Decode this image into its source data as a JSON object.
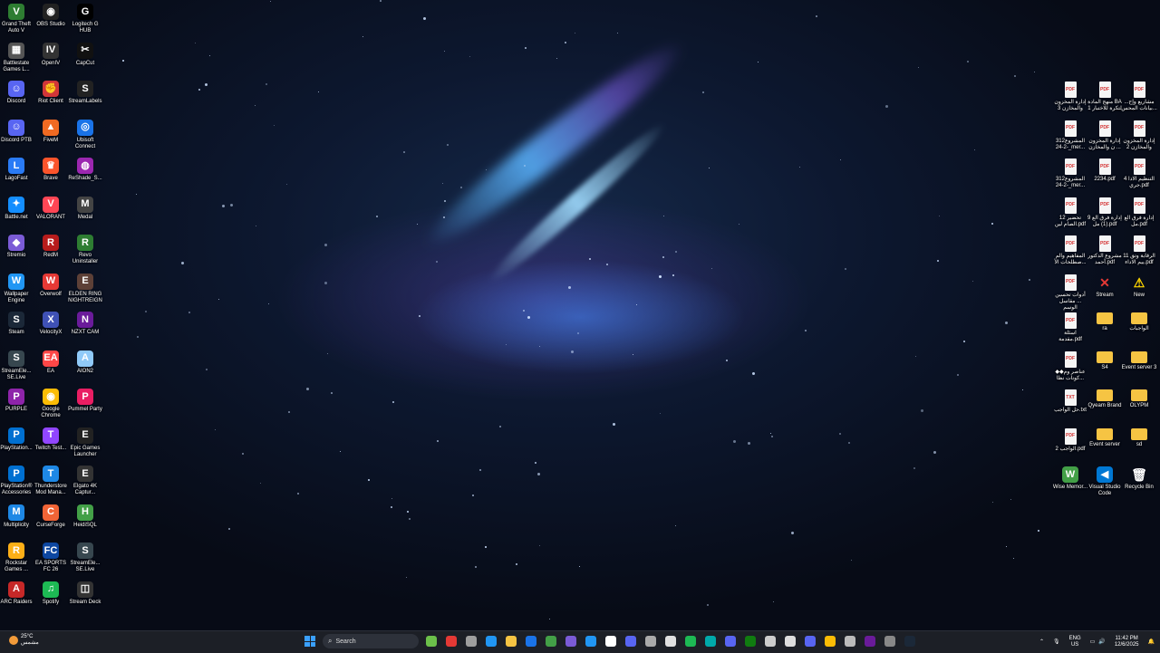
{
  "left_icons": [
    {
      "label": "Grand Theft Auto V",
      "glyph": "V",
      "color": "#2e7d32"
    },
    {
      "label": "OBS Studio",
      "glyph": "◉",
      "color": "#222"
    },
    {
      "label": "Logitech G HUB",
      "glyph": "G",
      "color": "#000"
    },
    {
      "label": "Battlestate Games L...",
      "glyph": "▦",
      "color": "#555"
    },
    {
      "label": "OpenIV",
      "glyph": "IV",
      "color": "#333"
    },
    {
      "label": "CapCut",
      "glyph": "✂",
      "color": "#111"
    },
    {
      "label": "Discord",
      "glyph": "☺",
      "color": "#5865f2"
    },
    {
      "label": "Riot Client",
      "glyph": "✊",
      "color": "#d13639"
    },
    {
      "label": "StreamLabels",
      "glyph": "S",
      "color": "#222"
    },
    {
      "label": "Discord PTB",
      "glyph": "☺",
      "color": "#5865f2"
    },
    {
      "label": "FiveM",
      "glyph": "▲",
      "color": "#f06a22"
    },
    {
      "label": "Ubisoft Connect",
      "glyph": "◎",
      "color": "#1a73e8"
    },
    {
      "label": "LagoFast",
      "glyph": "L",
      "color": "#2a7bf6"
    },
    {
      "label": "Brave",
      "glyph": "♛",
      "color": "#fb542b"
    },
    {
      "label": "ReShade_S...",
      "glyph": "◍",
      "color": "#9c27b0"
    },
    {
      "label": "Battle.net",
      "glyph": "✦",
      "color": "#148eff"
    },
    {
      "label": "VALORANT",
      "glyph": "V",
      "color": "#ff4655"
    },
    {
      "label": "Medal",
      "glyph": "M",
      "color": "#444"
    },
    {
      "label": "Stremio",
      "glyph": "◆",
      "color": "#7b5bd6"
    },
    {
      "label": "RedM",
      "glyph": "R",
      "color": "#b71c1c"
    },
    {
      "label": "Revo Uninstaller",
      "glyph": "R",
      "color": "#2e7d32"
    },
    {
      "label": "Wallpaper Engine",
      "glyph": "W",
      "color": "#2196f3"
    },
    {
      "label": "Overwolf",
      "glyph": "W",
      "color": "#e53935"
    },
    {
      "label": "ELDEN RING NIGHTREIGN",
      "glyph": "E",
      "color": "#5d4037"
    },
    {
      "label": "Steam",
      "glyph": "S",
      "color": "#1b2838"
    },
    {
      "label": "VelocityX",
      "glyph": "X",
      "color": "#3f51b5"
    },
    {
      "label": "NZXT CAM",
      "glyph": "N",
      "color": "#6a1b9a"
    },
    {
      "label": "StreamEle... SE.Live",
      "glyph": "S",
      "color": "#37474f"
    },
    {
      "label": "EA",
      "glyph": "EA",
      "color": "#ff4747"
    },
    {
      "label": "AION2",
      "glyph": "A",
      "color": "#90caf9"
    },
    {
      "label": "PURPLE",
      "glyph": "P",
      "color": "#8e24aa"
    },
    {
      "label": "Google Chrome",
      "glyph": "◉",
      "color": "#fbbc05"
    },
    {
      "label": "Pummel Party",
      "glyph": "P",
      "color": "#e91e63"
    },
    {
      "label": "PlayStation...",
      "glyph": "P",
      "color": "#0070d1"
    },
    {
      "label": "Twitch Test...",
      "glyph": "T",
      "color": "#9146ff"
    },
    {
      "label": "Epic Games Launcher",
      "glyph": "E",
      "color": "#222"
    },
    {
      "label": "PlayStation® Accessories",
      "glyph": "P",
      "color": "#0070d1"
    },
    {
      "label": "Thunderstore Mod Mana...",
      "glyph": "T",
      "color": "#1e88e5"
    },
    {
      "label": "Elgato 4K Captur...",
      "glyph": "E",
      "color": "#333"
    },
    {
      "label": "Multiplicity",
      "glyph": "M",
      "color": "#1e88e5"
    },
    {
      "label": "CurseForge",
      "glyph": "C",
      "color": "#f16436"
    },
    {
      "label": "HeidiSQL",
      "glyph": "H",
      "color": "#43a047"
    },
    {
      "label": "Rockstar Games ...",
      "glyph": "R",
      "color": "#fcaf17"
    },
    {
      "label": "EA SPORTS FC 26",
      "glyph": "FC",
      "color": "#0d47a1"
    },
    {
      "label": "StreamEle... SE.Live",
      "glyph": "S",
      "color": "#37474f"
    },
    {
      "label": "ARC Raiders",
      "glyph": "A",
      "color": "#c62828"
    },
    {
      "label": "Spotify",
      "glyph": "♫",
      "color": "#1db954"
    },
    {
      "label": "Stream Deck",
      "glyph": "◫",
      "color": "#333"
    }
  ],
  "right_icons": [
    {
      "label": "إدارة المخزون والمخازن 3",
      "glyph": "PDF",
      "color": "#f5f5f5"
    },
    {
      "label": "منهج المادة BA لتكرة للاختبار 1",
      "glyph": "PDF",
      "color": "#f5f5f5"
    },
    {
      "label": "مشاريع وإح... بيانات المحس...",
      "glyph": "PDF",
      "color": "#f5f5f5"
    },
    {
      "label": "المشروع312 -2-24_mer...",
      "glyph": "PDF",
      "color": "#f5f5f5"
    },
    {
      "label": "إدارة المخزون ... ن والمخازن",
      "glyph": "PDF",
      "color": "#f5f5f5"
    },
    {
      "label": "إدارة المخزون والمخازن 2",
      "glyph": "PDF",
      "color": "#f5f5f5"
    },
    {
      "label": "المشروع312 -2-24_mer...",
      "glyph": "PDF",
      "color": "#f5f5f5"
    },
    {
      "label": "2234.pdf",
      "glyph": "PDF",
      "color": "#f5f5f5"
    },
    {
      "label": "التنظيم الادا 4 جري.pdf",
      "glyph": "PDF",
      "color": "#f5f5f5"
    },
    {
      "label": "12 تحضير الصام لين.pdf",
      "glyph": "PDF",
      "color": "#f5f5f5"
    },
    {
      "label": "إدارة فرق الع 9 (1) مل.pdf",
      "glyph": "PDF",
      "color": "#f5f5f5"
    },
    {
      "label": "إدارة فرق الع مل.pdf",
      "glyph": "PDF",
      "color": "#f5f5f5"
    },
    {
      "label": "المفاهيم والم صطلحات الأ...",
      "glyph": "PDF",
      "color": "#f5f5f5"
    },
    {
      "label": "مشروع الدكتور أحمد.pdf",
      "glyph": "PDF",
      "color": "#f5f5f5"
    },
    {
      "label": "الرقابة وتق 11 ييم الاداء.pdf",
      "glyph": "PDF",
      "color": "#f5f5f5"
    },
    {
      "label": "أدوات تحسين ... مقاسل الوسم",
      "glyph": "PDF",
      "color": "#f5f5f5"
    },
    {
      "label": "Stream",
      "glyph": "✕",
      "color": "transparent"
    },
    {
      "label": "New",
      "glyph": "⚠",
      "color": "transparent"
    },
    {
      "label": "اسئلة مقدمة.pdf",
      "glyph": "PDF",
      "color": "#f5f5f5"
    },
    {
      "label": "ra",
      "glyph": "▬",
      "color": "#f6c443"
    },
    {
      "label": "الواجبات",
      "glyph": "▬",
      "color": "#f6c443"
    },
    {
      "label": "عناصر وم◆◆ كونات نظا...",
      "glyph": "PDF",
      "color": "#f5f5f5"
    },
    {
      "label": "S4",
      "glyph": "▬",
      "color": "#f6c443"
    },
    {
      "label": "Event server 3",
      "glyph": "▬",
      "color": "#f6c443"
    },
    {
      "label": "حل الواجب.txt",
      "glyph": "TXT",
      "color": "#f5f5f5"
    },
    {
      "label": "Qyeam Brand",
      "glyph": "▬",
      "color": "#f6c443"
    },
    {
      "label": "OLYPM",
      "glyph": "▬",
      "color": "#f6c443"
    },
    {
      "label": "الواجب 2.pdf",
      "glyph": "PDF",
      "color": "#f5f5f5"
    },
    {
      "label": "Event server",
      "glyph": "▬",
      "color": "#f6c443"
    },
    {
      "label": "sd",
      "glyph": "▬",
      "color": "#f6c443"
    },
    {
      "label": "Wise Memor...",
      "glyph": "W",
      "color": "#43a047"
    },
    {
      "label": "Visual Studio Code",
      "glyph": "◀",
      "color": "#0078d4"
    },
    {
      "label": "Recycle Bin",
      "glyph": "🗑",
      "color": "transparent"
    }
  ],
  "taskbar": {
    "weather_temp": "25°C",
    "weather_desc": "مشمس",
    "search_placeholder": "Search",
    "apps": [
      "#6cc04a",
      "#e53935",
      "#9e9e9e",
      "#2196f3",
      "#f6c443",
      "#1a73e8",
      "#43a047",
      "#7b5bd6",
      "#2196f3",
      "#fff",
      "#5865f2",
      "#aaa",
      "#e0e0e0",
      "#1db954",
      "#0aa",
      "#5865f2",
      "#107c10",
      "#ccc",
      "#ddd",
      "#5865f2",
      "#fbbc05",
      "#bbb",
      "#6a1b9a",
      "#888",
      "#1b2838"
    ],
    "language_top": "ENG",
    "language_bottom": "US",
    "time": "11:42 PM",
    "date": "12/6/2025"
  }
}
